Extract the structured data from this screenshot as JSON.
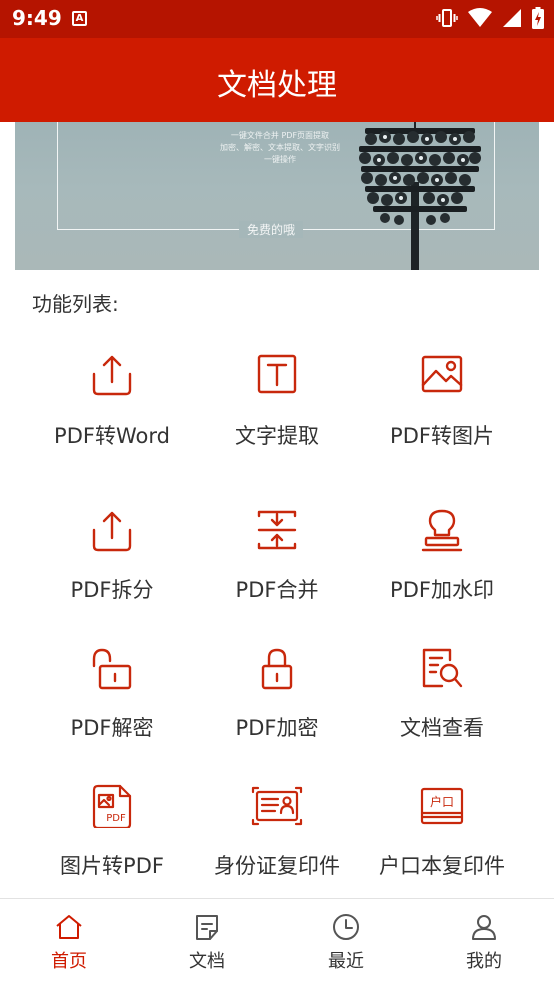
{
  "status_bar": {
    "time": "9:49",
    "notification_letter": "A"
  },
  "app_bar": {
    "title": "文档处理"
  },
  "banner": {
    "line1": "一键文件合并 PDF页面提取",
    "line2": "加密、解密、文本提取、文字识别",
    "line3": "一键操作",
    "free_label": "免费的哦"
  },
  "section": {
    "title": "功能列表:"
  },
  "features": [
    {
      "label": "PDF转Word",
      "icon": "upload-tray-icon"
    },
    {
      "label": "文字提取",
      "icon": "text-box-icon"
    },
    {
      "label": "PDF转图片",
      "icon": "image-icon"
    },
    {
      "label": "PDF拆分",
      "icon": "upload-tray-icon"
    },
    {
      "label": "PDF合并",
      "icon": "merge-arrows-icon"
    },
    {
      "label": "PDF加水印",
      "icon": "stamp-icon"
    },
    {
      "label": "PDF解密",
      "icon": "unlock-icon"
    },
    {
      "label": "PDF加密",
      "icon": "lock-icon"
    },
    {
      "label": "文档查看",
      "icon": "document-search-icon"
    },
    {
      "label": "图片转PDF",
      "icon": "pdf-image-file-icon"
    },
    {
      "label": "身份证复印件",
      "icon": "id-card-icon"
    },
    {
      "label": "户口本复印件",
      "icon": "household-book-icon"
    }
  ],
  "bottom_nav": {
    "items": [
      {
        "label": "首页",
        "icon": "home-icon",
        "active": true
      },
      {
        "label": "文档",
        "icon": "document-icon",
        "active": false
      },
      {
        "label": "最近",
        "icon": "clock-icon",
        "active": false
      },
      {
        "label": "我的",
        "icon": "person-icon",
        "active": false
      }
    ]
  },
  "colors": {
    "status_bar": "#b51400",
    "app_bar": "#cf1b00",
    "accent": "#cf1b00",
    "icon": "#c8280c"
  }
}
